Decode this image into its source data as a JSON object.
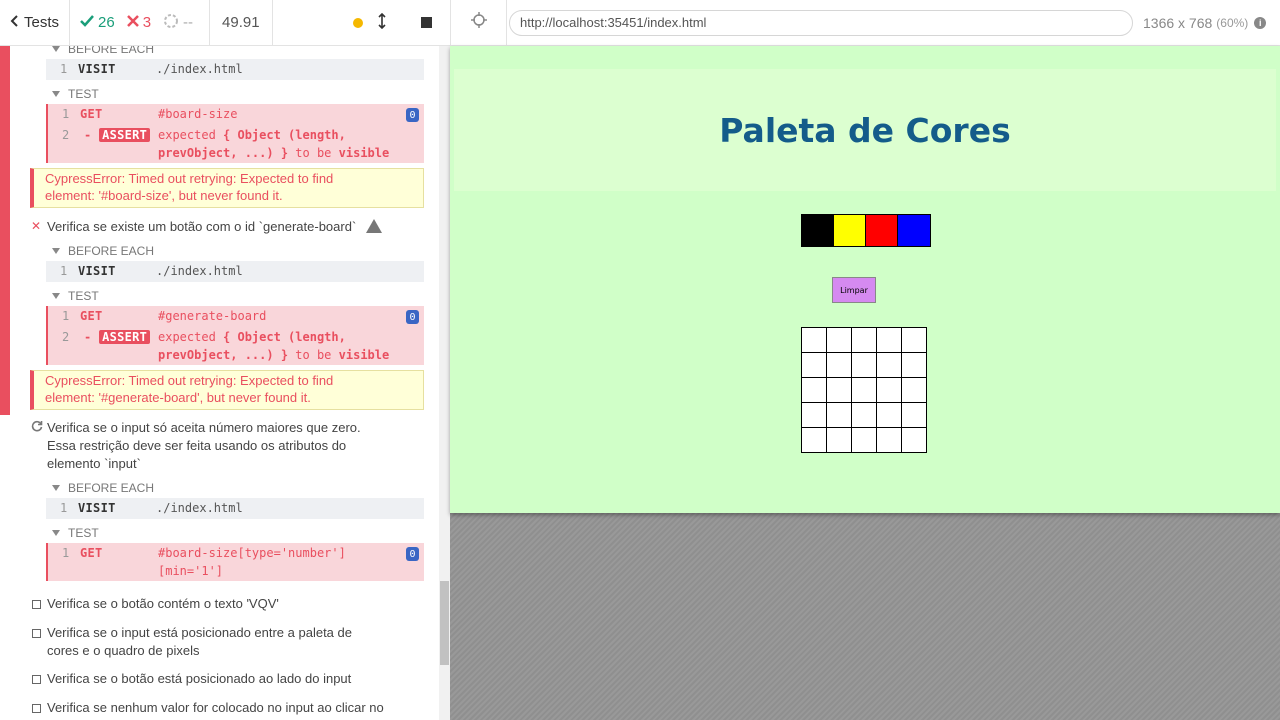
{
  "runner": {
    "tests_label": "Tests",
    "passed": "26",
    "failed": "3",
    "pending": "--",
    "duration": "49.91"
  },
  "browser": {
    "url": "http://localhost:35451/index.html",
    "viewport": "1366 x 768",
    "zoom": "(60%)"
  },
  "reporter": {
    "hook_before_each": "BEFORE EACH",
    "hook_test": "TEST",
    "visit_name": "VISIT",
    "visit_path": "./index.html",
    "get_name": "GET",
    "assert_name": "ASSERT",
    "badge_zero": "0",
    "assert_expected": "expected",
    "assert_obj_1": "{ Object (length,",
    "assert_obj_2": "prevObject, ...) }",
    "assert_to_be": "to be",
    "assert_visible": "visible",
    "block1": {
      "get_selector": "#board-size",
      "error_line1": "CypressError: Timed out retrying: Expected to find",
      "error_line2": "element: '#board-size', but never found it."
    },
    "test2": {
      "title": "Verifica se existe um botão com o id `generate-board`",
      "get_selector": "#generate-board",
      "error_line1": "CypressError: Timed out retrying: Expected to find",
      "error_line2": "element: '#generate-board', but never found it."
    },
    "test3": {
      "title_line1": "Verifica se o input só aceita número maiores que zero.",
      "title_line2": "Essa restrição deve ser feita usando os atributos do",
      "title_line3": "elemento `input`",
      "get_selector_line1": "#board-size[type='number']",
      "get_selector_line2": "[min='1']"
    },
    "pending_tests": [
      "Verifica se o botão contém o texto 'VQV'",
      "Verifica se o input está posicionado entre a paleta de",
      "cores e o quadro de pixels",
      "Verifica se o botão está posicionado ao lado do input",
      "Verifica se nenhum valor for colocado no input ao clicar no"
    ]
  },
  "app": {
    "title": "Paleta de Cores",
    "palette_colors": [
      "#000000",
      "#ffff00",
      "#ff0000",
      "#0000ff"
    ],
    "clear_button": "Limpar",
    "board_size": 5
  }
}
